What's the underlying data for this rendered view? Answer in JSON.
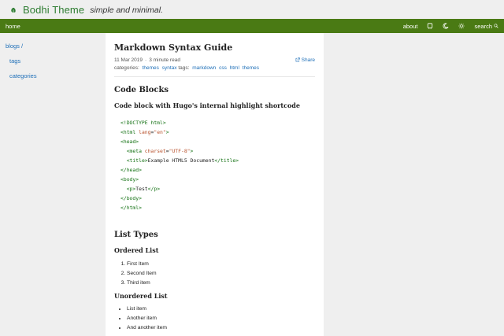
{
  "site": {
    "title": "Bodhi Theme",
    "tagline": "simple and minimal."
  },
  "nav": {
    "home": "home",
    "about": "about",
    "search": "search"
  },
  "sidebar": {
    "items": [
      {
        "label": "blogs /"
      },
      {
        "label": "tags"
      },
      {
        "label": "categories"
      }
    ]
  },
  "post": {
    "title": "Markdown Syntax Guide",
    "date": "11 Mar 2019",
    "separator": "·",
    "reading_time": "3 minute read",
    "share": "Share",
    "categories_label": "categories:",
    "categories": [
      "themes",
      "syntax"
    ],
    "tags_label": "tags:",
    "tags": [
      "markdown",
      "css",
      "html",
      "themes"
    ]
  },
  "sections": {
    "code_blocks": "Code Blocks",
    "code_caption": "Code block with Hugo's internal highlight shortcode",
    "list_types": "List Types",
    "ordered_list": "Ordered List",
    "ordered_items": [
      "First Item",
      "Second Item",
      "Third item"
    ],
    "unordered_list": "Unordered List",
    "unordered_items": [
      "List item",
      "Another item",
      "And another item"
    ]
  },
  "code_lines": [
    "<!DOCTYPE html>",
    "<html lang=\"en\">",
    "<head>",
    "  <meta charset=\"UTF-8\">",
    "  <title>Example HTML5 Document</title>",
    "</head>",
    "<body>",
    "  <p>Test</p>",
    "</body>",
    "</html>"
  ],
  "colors": {
    "navbar": "#4a7a14",
    "brand": "#2e7d32",
    "link": "#1e6fb8",
    "code_tag": "#137113",
    "code_attr": "#b8512c"
  },
  "icons": [
    "leaf-icon",
    "github-icon",
    "moon-icon",
    "sun-icon",
    "search-icon",
    "share-icon"
  ]
}
